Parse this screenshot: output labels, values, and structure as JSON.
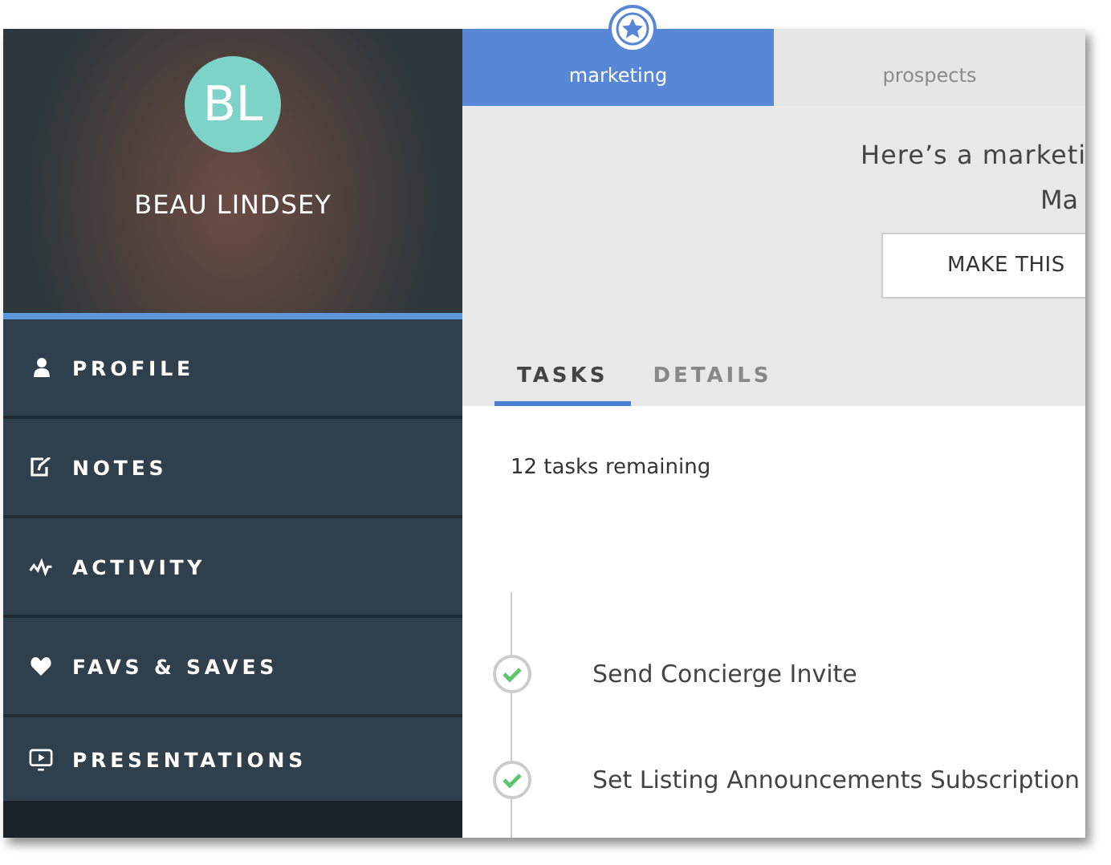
{
  "profile": {
    "initials": "BL",
    "name": "BEAU LINDSEY"
  },
  "nav": [
    {
      "kind": "person",
      "label": "PROFILE"
    },
    {
      "kind": "edit",
      "label": "NOTES"
    },
    {
      "kind": "pulse",
      "label": "ACTIVITY"
    },
    {
      "kind": "heart",
      "label": "FAVS & SAVES"
    },
    {
      "kind": "screen",
      "label": "PRESENTATIONS"
    }
  ],
  "stages": [
    {
      "label": "marketing",
      "selected": true
    },
    {
      "label": "prospects",
      "selected": false
    }
  ],
  "banner": {
    "headline": "Here’s a marketi",
    "subline": "Ma",
    "button": "MAKE THIS"
  },
  "tabs": [
    {
      "label": "TASKS",
      "selected": true
    },
    {
      "label": "DETAILS",
      "selected": false
    }
  ],
  "remaining": "12 tasks remaining",
  "tasks": [
    {
      "label": "Send Concierge Invite",
      "checked": true
    },
    {
      "label": "Set Listing Announcements Subscription",
      "checked": true
    }
  ]
}
